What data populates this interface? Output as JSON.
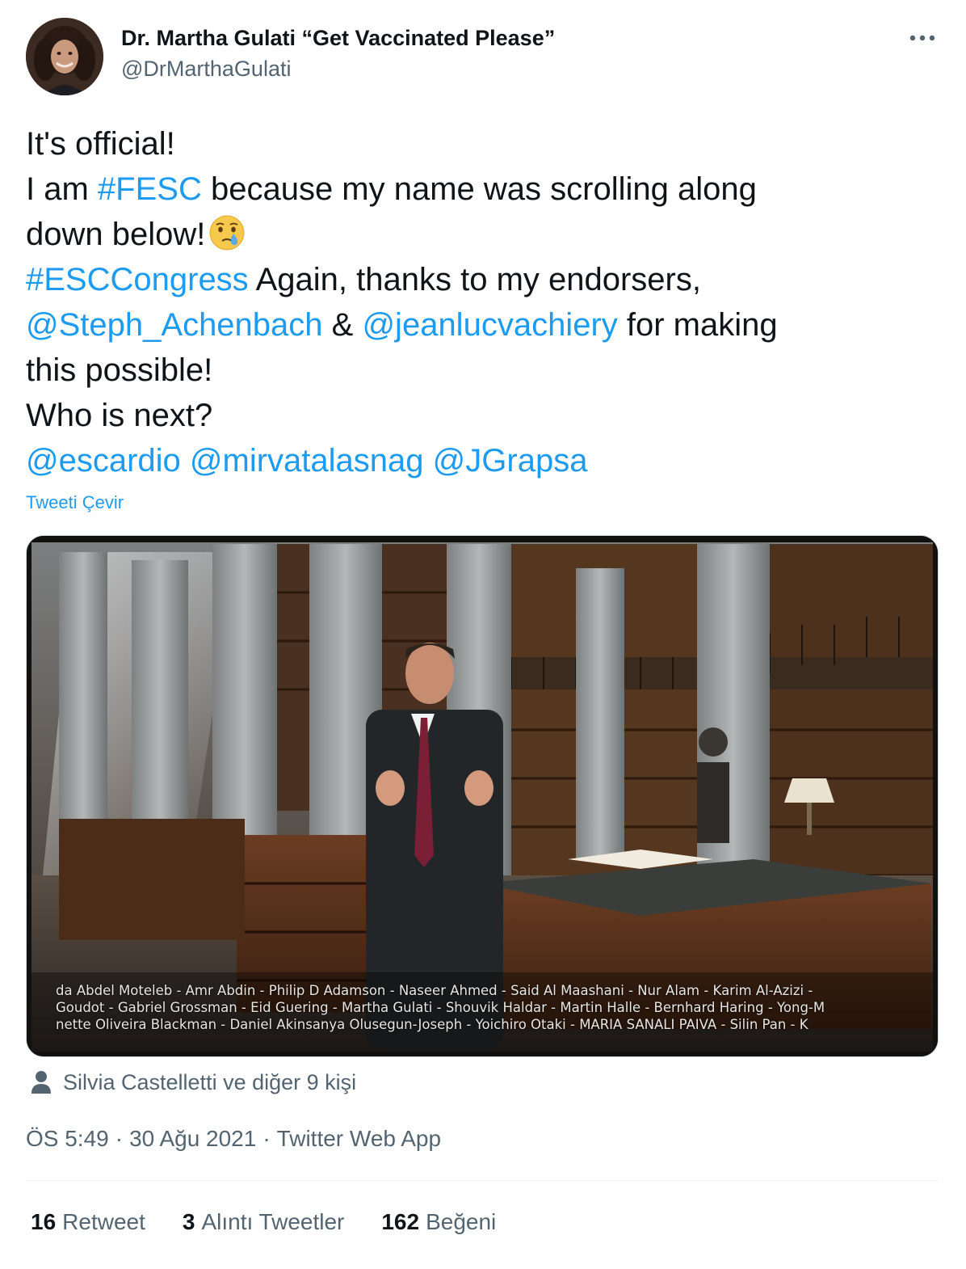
{
  "author": {
    "display_name": "Dr. Martha Gulati “Get Vaccinated Please”",
    "handle": "@DrMarthaGulati"
  },
  "more_icon": "more-horizontal-icon",
  "tweet": {
    "line1": "It's official!",
    "line2_pre": "I am ",
    "hashtag_fesc": "#FESC",
    "line2_post": " because my name was scrolling along",
    "line3": "down below!",
    "emoji": "face-holding-back-tears-emoji",
    "hashtag_esc": "#ESCCongress",
    "line4_post": " Again, thanks to my endorsers,",
    "mention_steph": "@Steph_Achenbach",
    "amp": " & ",
    "mention_jeanluc": "@jeanlucvachiery",
    "line5_post": " for making",
    "line6": "this possible!",
    "line7": "Who is next?",
    "mention_escardio": "@escardio",
    "mention_mirvat": "@mirvatalasnag",
    "mention_jgrapsa": "@JGrapsa"
  },
  "translate_label": "Tweeti Çevir",
  "media": {
    "caption_line1": "da Abdel Moteleb - Amr Abdin - Philip D Adamson - Naseer Ahmed - Said Al Maashani - Nur Alam - Karim Al-Azizi -",
    "caption_line2": "Goudot - Gabriel Grossman - Eid Guering - Martha Gulati - Shouvik Haldar - Martin Halle - Bernhard Haring - Yong-M",
    "caption_line3": "nette Oliveira Blackman - Daniel Akinsanya Olusegun-Joseph - Yoichiro Otaki - MARIA SANALI PAIVA - Silin Pan - K"
  },
  "tagged": {
    "icon": "person-icon",
    "label": "Silvia Castelletti ve diğer 9 kişi"
  },
  "meta": {
    "time": "ÖS 5:49",
    "date": "30 Ağu 2021",
    "source": "Twitter Web App",
    "separator": "·"
  },
  "stats": {
    "retweets_count": "16",
    "retweets_label": "Retweet",
    "quotes_count": "3",
    "quotes_label": "Alıntı Tweetler",
    "likes_count": "162",
    "likes_label": "Beğeni"
  },
  "colors": {
    "link": "#1d9bf0",
    "secondary_text": "#536471",
    "primary_text": "#0f1419"
  }
}
